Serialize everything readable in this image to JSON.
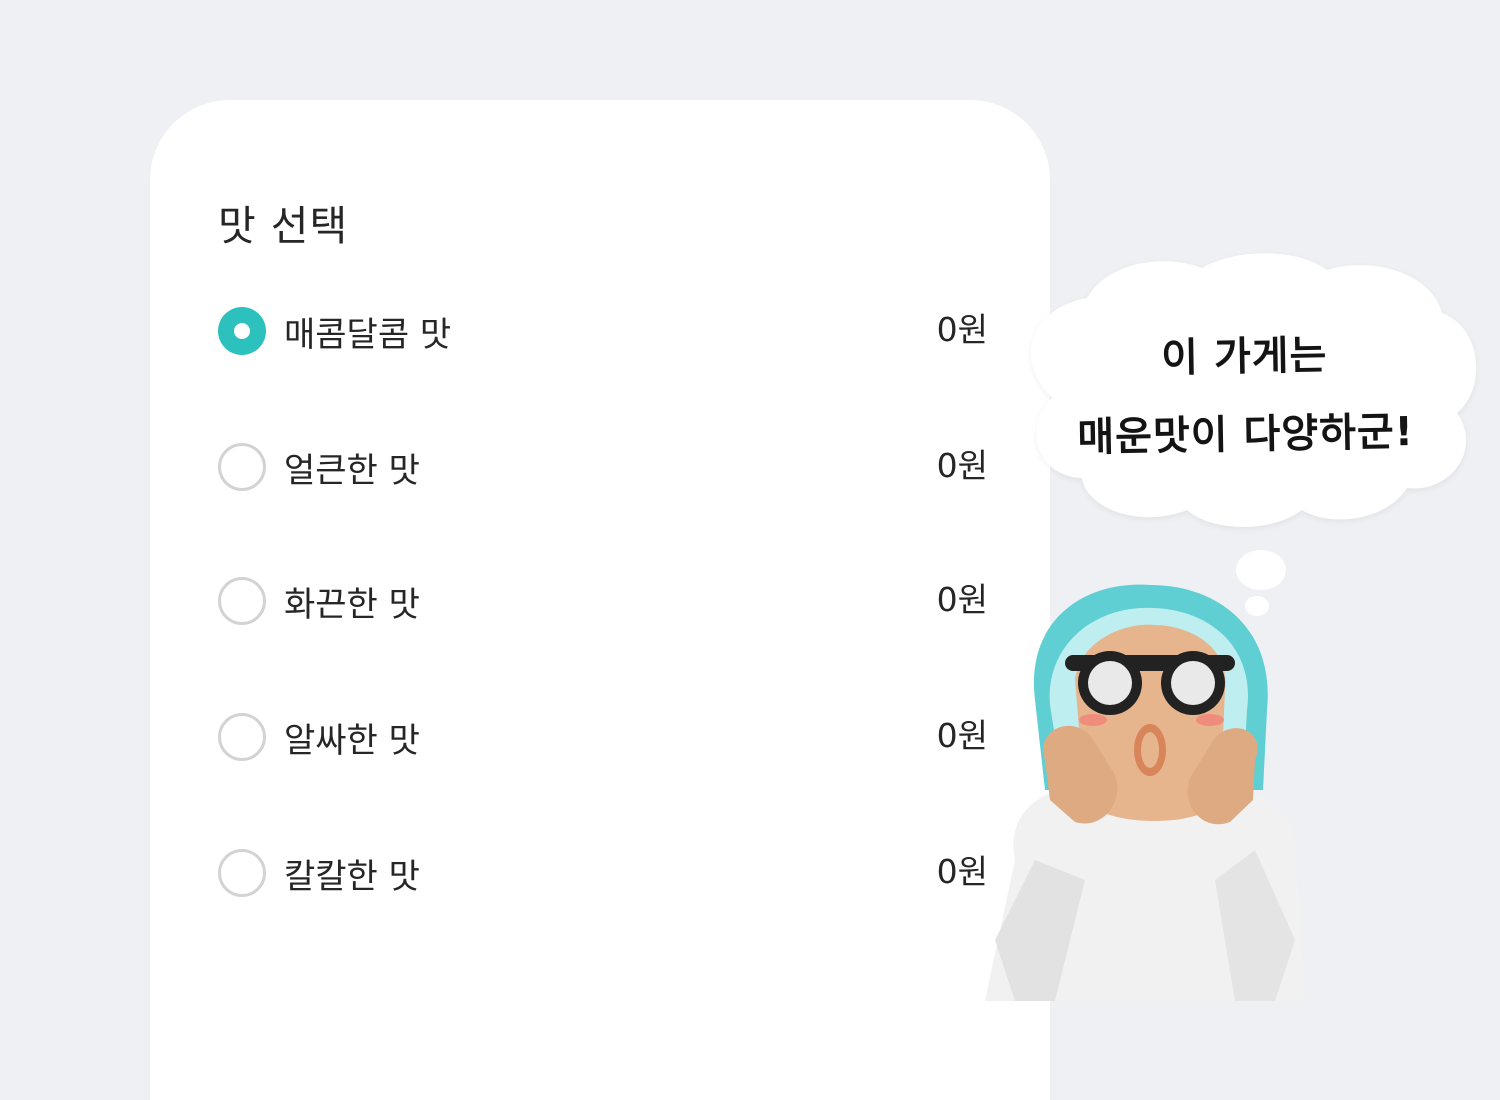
{
  "menu": {
    "title": "맛 선택",
    "options": [
      {
        "label": "매콤달콤 맛",
        "price": "0원",
        "selected": true
      },
      {
        "label": "얼큰한 맛",
        "price": "0원",
        "selected": false
      },
      {
        "label": "화끈한 맛",
        "price": "0원",
        "selected": false
      },
      {
        "label": "알싸한 맛",
        "price": "0원",
        "selected": false
      },
      {
        "label": "칼칼한 맛",
        "price": "0원",
        "selected": false
      }
    ]
  },
  "bubble": {
    "line1": "이 가게는",
    "line2": "매운맛이 다양하군!"
  },
  "colors": {
    "accent": "#2cc1bc",
    "background": "#eef0f4",
    "card": "#ffffff",
    "radio_border": "#d3d3d3"
  },
  "icons": {
    "mascot": "carved-wooden-figure-with-goggles-illustration",
    "bubble": "thought-bubble"
  }
}
